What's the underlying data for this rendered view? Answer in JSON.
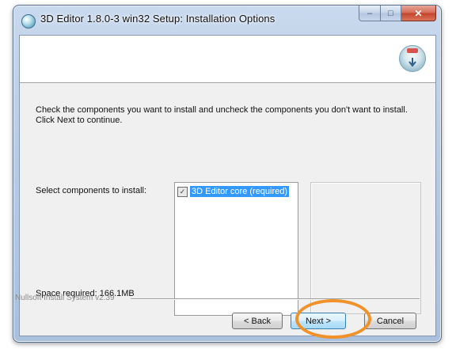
{
  "window": {
    "title": "3D Editor 1.8.0-3 win32 Setup: Installation Options",
    "caption_buttons": {
      "minimize": "–",
      "maximize": "□",
      "close": "✕"
    }
  },
  "instructions": "Check the components you want to install and uncheck the components you don't want to install. Click Next to continue.",
  "components": {
    "select_label": "Select components to install:",
    "items": [
      {
        "label": "3D Editor core (required)",
        "checked": true,
        "mark": "✓"
      }
    ],
    "space_required": "Space required: 166.1MB"
  },
  "footer": {
    "branding": "Nullsoft Install System v2.39",
    "back_label": "< Back",
    "next_label": "Next >",
    "cancel_label": "Cancel"
  },
  "colors": {
    "highlight_ring": "#f0912a",
    "selection": "#3399ff"
  }
}
